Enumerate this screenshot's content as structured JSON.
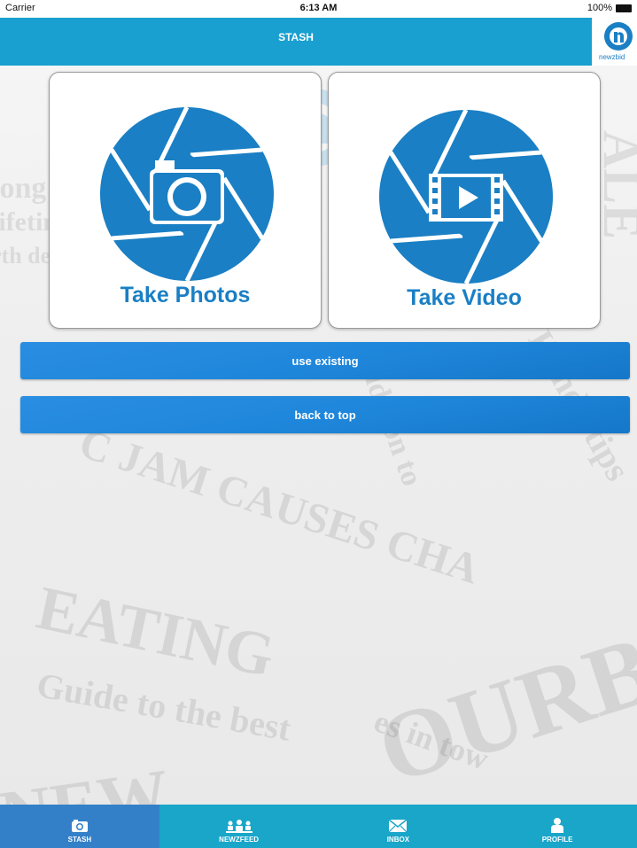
{
  "status_bar": {
    "carrier": "Carrier",
    "time": "6:13 AM",
    "battery": "100%"
  },
  "header": {
    "title": "STASH",
    "logo_label": "newzbid"
  },
  "cards": {
    "photo": {
      "label": "Take Photos",
      "icon": "camera-shutter-icon"
    },
    "video": {
      "label": "Take Video",
      "icon": "video-shutter-icon"
    }
  },
  "buttons": {
    "use_existing": "use existing",
    "back_to_top": "back to top"
  },
  "tabs": [
    {
      "label": "STASH",
      "icon": "camera-icon",
      "active": true
    },
    {
      "label": "NEWZFEED",
      "icon": "people-icon",
      "active": false
    },
    {
      "label": "INBOX",
      "icon": "envelope-icon",
      "active": false
    },
    {
      "label": "PROFILE",
      "icon": "person-icon",
      "active": false
    }
  ],
  "colors": {
    "header": "#1aa0d0",
    "brand_blue": "#1a7fc4",
    "tabbar": "#19a6c9",
    "tab_active": "#3480c8",
    "button": "#1f87db"
  }
}
